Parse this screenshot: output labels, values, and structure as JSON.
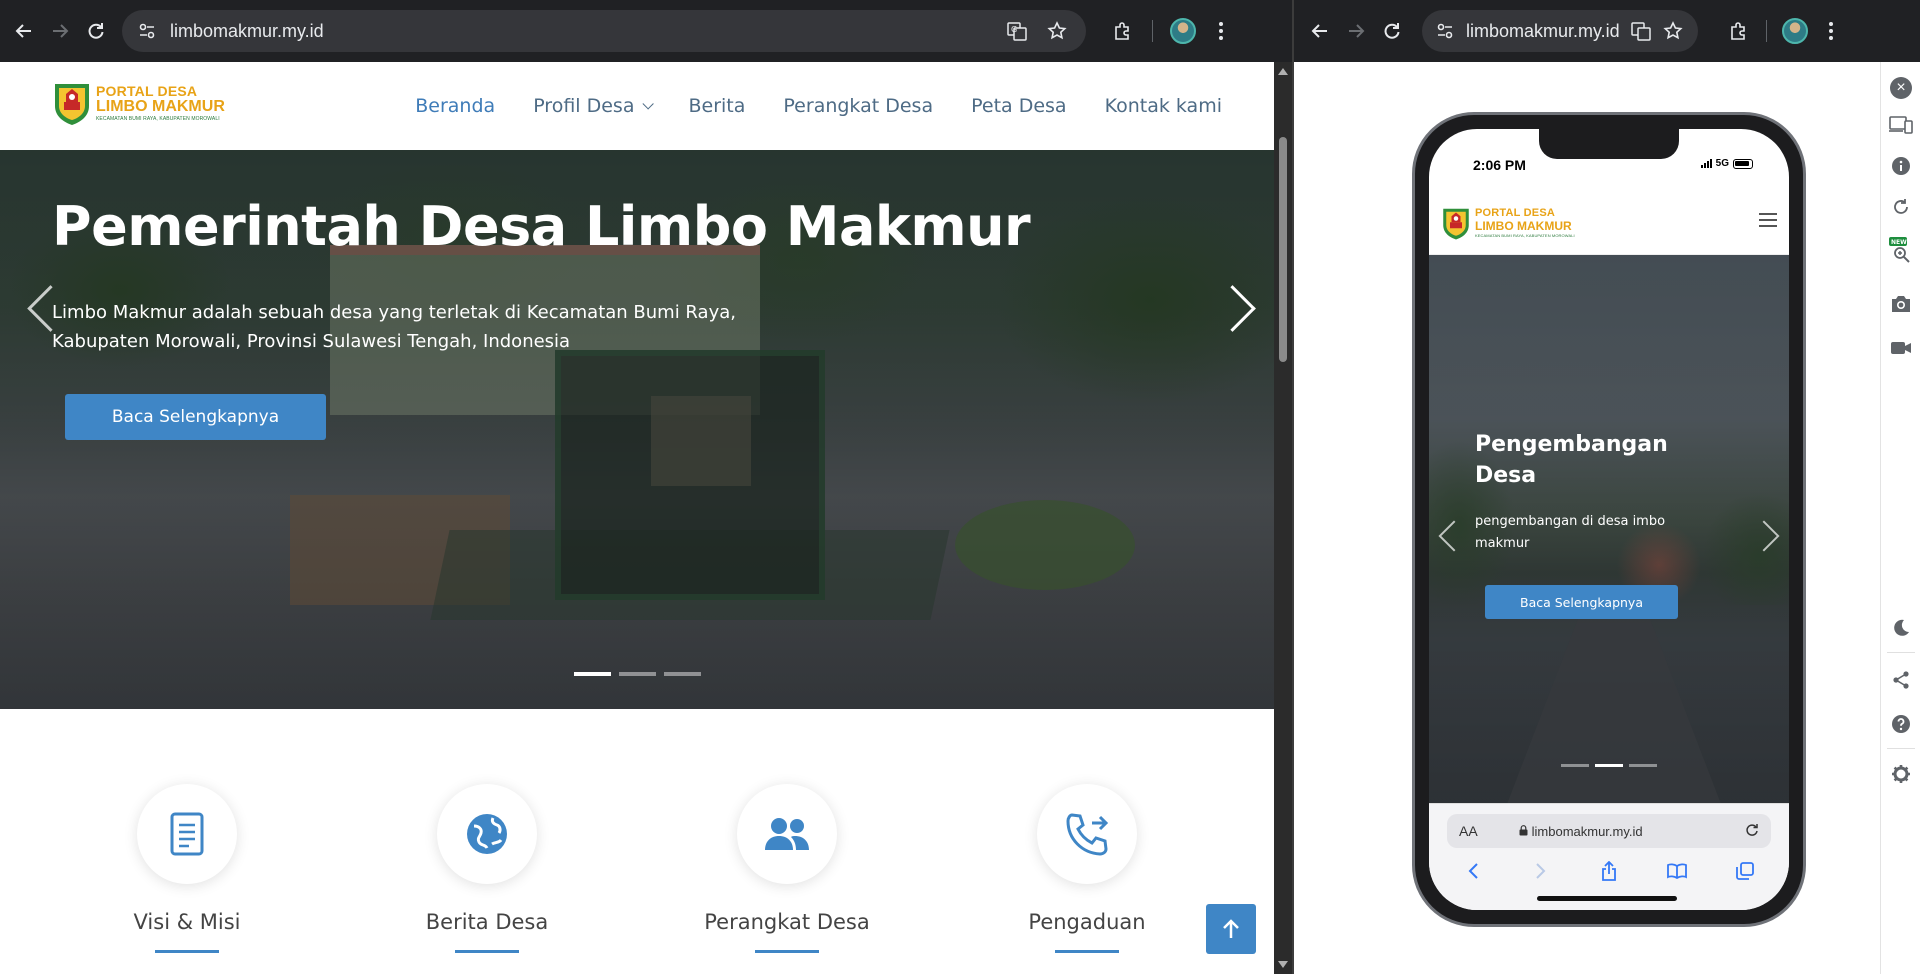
{
  "left_window": {
    "toolbar": {
      "url": "limbomakmur.my.id",
      "back": "back-arrow",
      "forward": "forward-arrow",
      "reload": "reload"
    },
    "site": {
      "logo": {
        "line1": "PORTAL DESA",
        "line2": "LIMBO MAKMUR",
        "line3": "KECAMATAN BUMI RAYA, KABUPATEN MOROWALI"
      },
      "nav": [
        {
          "label": "Beranda",
          "active": true
        },
        {
          "label": "Profil Desa",
          "dropdown": true
        },
        {
          "label": "Berita"
        },
        {
          "label": "Perangkat Desa"
        },
        {
          "label": "Peta Desa"
        },
        {
          "label": "Kontak kami"
        }
      ]
    },
    "hero": {
      "title": "Pemerintah Desa Limbo Makmur",
      "description": "Limbo Makmur adalah sebuah desa yang terletak di Kecamatan Bumi Raya, Kabupaten Morowali, Provinsi Sulawesi Tengah, Indonesia",
      "button": "Baca Selengkapnya",
      "slides": 3,
      "active_slide": 1
    },
    "features": [
      {
        "label": "Visi & Misi",
        "icon": "document-icon"
      },
      {
        "label": "Berita Desa",
        "icon": "globe-icon"
      },
      {
        "label": "Perangkat Desa",
        "icon": "users-icon"
      },
      {
        "label": "Pengaduan",
        "icon": "phone-forward-icon"
      }
    ],
    "accent": "#3f86c6"
  },
  "right_window": {
    "toolbar": {
      "url": "limbomakmur.my.id"
    },
    "phone": {
      "status": {
        "time": "2:06 PM",
        "network": "5G"
      },
      "logo": {
        "line1": "PORTAL DESA",
        "line2": "LIMBO MAKMUR",
        "line3": "KECAMATAN BUMI RAYA, KABUPATEN MOROWALI"
      },
      "hero": {
        "title": "Pengembangan Desa",
        "description": "pengembangan di desa imbo makmur",
        "button": "Baca Selengkapnya",
        "slides": 3,
        "active_slide": 2
      },
      "safari": {
        "aa": "AA",
        "url": "limbomakmur.my.id"
      }
    },
    "devtools_panel": [
      "close",
      "devices",
      "info",
      "rotate",
      "zoom",
      "screenshot",
      "record",
      "dark-mode",
      "share",
      "help",
      "settings"
    ],
    "new_badge": "NEW"
  }
}
